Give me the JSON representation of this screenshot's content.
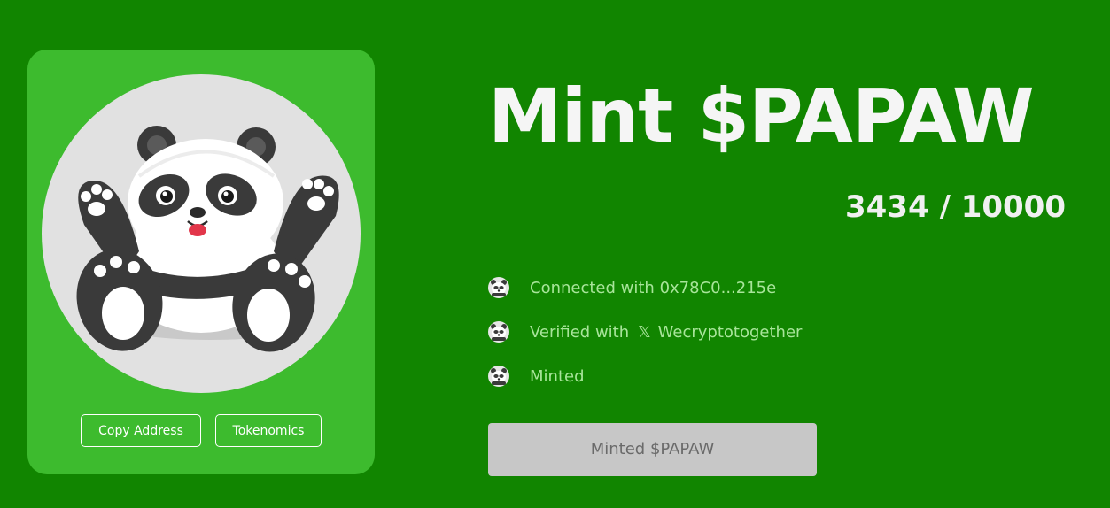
{
  "card": {
    "buttons": {
      "copy_address": "Copy Address",
      "tokenomics": "Tokenomics"
    }
  },
  "mint": {
    "title": "Mint $PAPAW",
    "counter": "3434 / 10000",
    "progress": {
      "minted": 3434,
      "total": 10000
    }
  },
  "status": {
    "connected_prefix": "Connected with",
    "wallet": "0x78C0...215e",
    "verified_prefix": "Verified with",
    "x_glyph": "𝕏",
    "x_handle": "Wecryptotogether",
    "minted": "Minted"
  },
  "mint_button": {
    "label": "Minted $PAPAW"
  },
  "colors": {
    "page_bg": "#118500",
    "card_bg": "#3dbb2e",
    "status_text": "#a8e59a",
    "button_disabled": "#c7c7c7"
  },
  "icons": {
    "hero": "panda-mascot",
    "status": "panda-avatar-icon",
    "x": "x-logo-icon"
  }
}
